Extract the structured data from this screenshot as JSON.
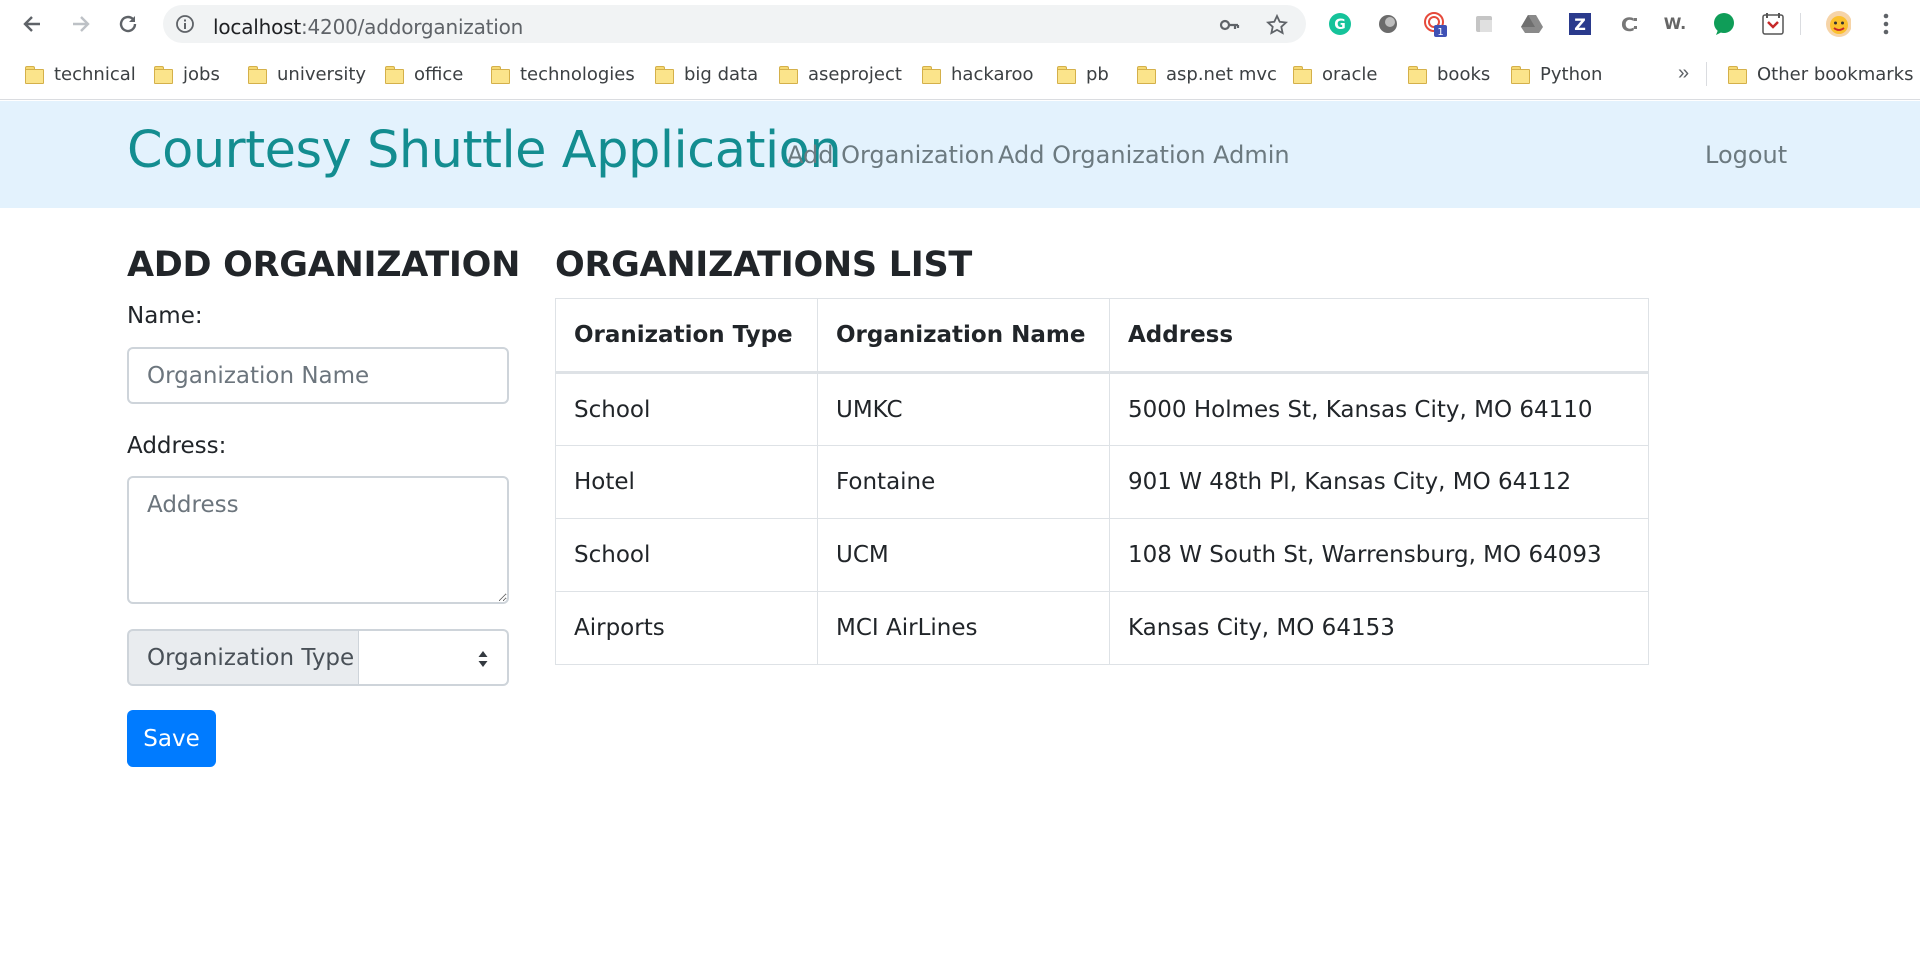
{
  "browser": {
    "url_host": "localhost",
    "url_path": ":4200/addorganization",
    "extension_badge": "1",
    "bookmarks": [
      "technical",
      "jobs",
      "university",
      "office",
      "technologies",
      "big data",
      "aseproject",
      "hackaroo",
      "pb",
      "asp.net mvc",
      "oracle",
      "books",
      "Python"
    ],
    "bookmarks_overflow": "»",
    "other_bookmarks": "Other bookmarks"
  },
  "navbar": {
    "brand": "Courtesy Shuttle Application",
    "links": [
      "Add Organization",
      "Add Organization Admin"
    ],
    "logout": "Logout",
    "brand_color": "#138d90",
    "background": "#e3f2fd"
  },
  "form": {
    "title": "ADD ORGANIZATION",
    "name_label": "Name:",
    "name_placeholder": "Organization Name",
    "name_value": "",
    "address_label": "Address:",
    "address_placeholder": "Address",
    "address_value": "",
    "type_label": "Organization Type",
    "type_selected": "",
    "save_label": "Save",
    "save_color": "#007bff"
  },
  "list": {
    "title": "ORGANIZATIONS LIST",
    "headers": [
      "Oranization Type",
      "Organization Name",
      "Address"
    ],
    "rows": [
      [
        "School",
        "UMKC",
        "5000 Holmes St, Kansas City, MO 64110"
      ],
      [
        "Hotel",
        "Fontaine",
        "901 W 48th Pl, Kansas City, MO 64112"
      ],
      [
        "School",
        "UCM",
        "108 W South St, Warrensburg, MO 64093"
      ],
      [
        "Airports",
        "MCI AirLines",
        "Kansas City, MO 64153"
      ]
    ]
  }
}
